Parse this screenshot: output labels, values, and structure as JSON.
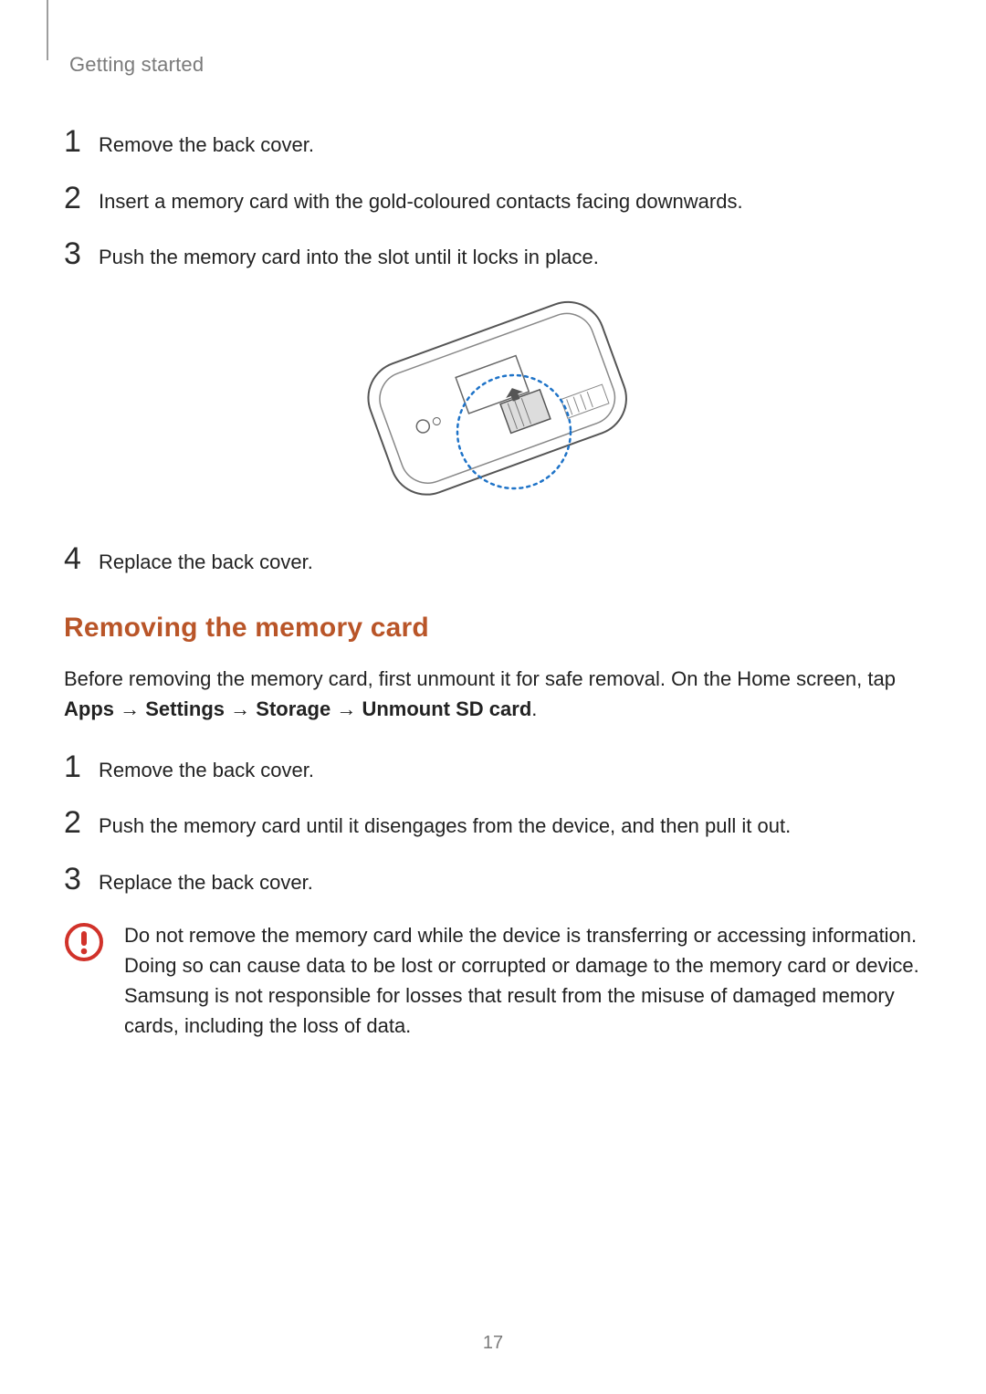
{
  "header": {
    "section_title": "Getting started"
  },
  "insert_steps": [
    {
      "n": "1",
      "text": "Remove the back cover."
    },
    {
      "n": "2",
      "text": "Insert a memory card with the gold-coloured contacts facing downwards."
    },
    {
      "n": "3",
      "text": "Push the memory card into the slot until it locks in place."
    },
    {
      "n": "4",
      "text": "Replace the back cover."
    }
  ],
  "section_heading": "Removing the memory card",
  "intro_prefix": "Before removing the memory card, first unmount it for safe removal. On the Home screen, tap ",
  "nav": {
    "apps": "Apps",
    "settings": "Settings",
    "storage": "Storage",
    "unmount": "Unmount SD card",
    "arrow": "→"
  },
  "period": ".",
  "remove_steps": [
    {
      "n": "1",
      "text": "Remove the back cover."
    },
    {
      "n": "2",
      "text": "Push the memory card until it disengages from the device, and then pull it out."
    },
    {
      "n": "3",
      "text": "Replace the back cover."
    }
  ],
  "caution_text": "Do not remove the memory card while the device is transferring or accessing information. Doing so can cause data to be lost or corrupted or damage to the memory card or device. Samsung is not responsible for losses that result from the misuse of damaged memory cards, including the loss of data.",
  "page_number": "17"
}
